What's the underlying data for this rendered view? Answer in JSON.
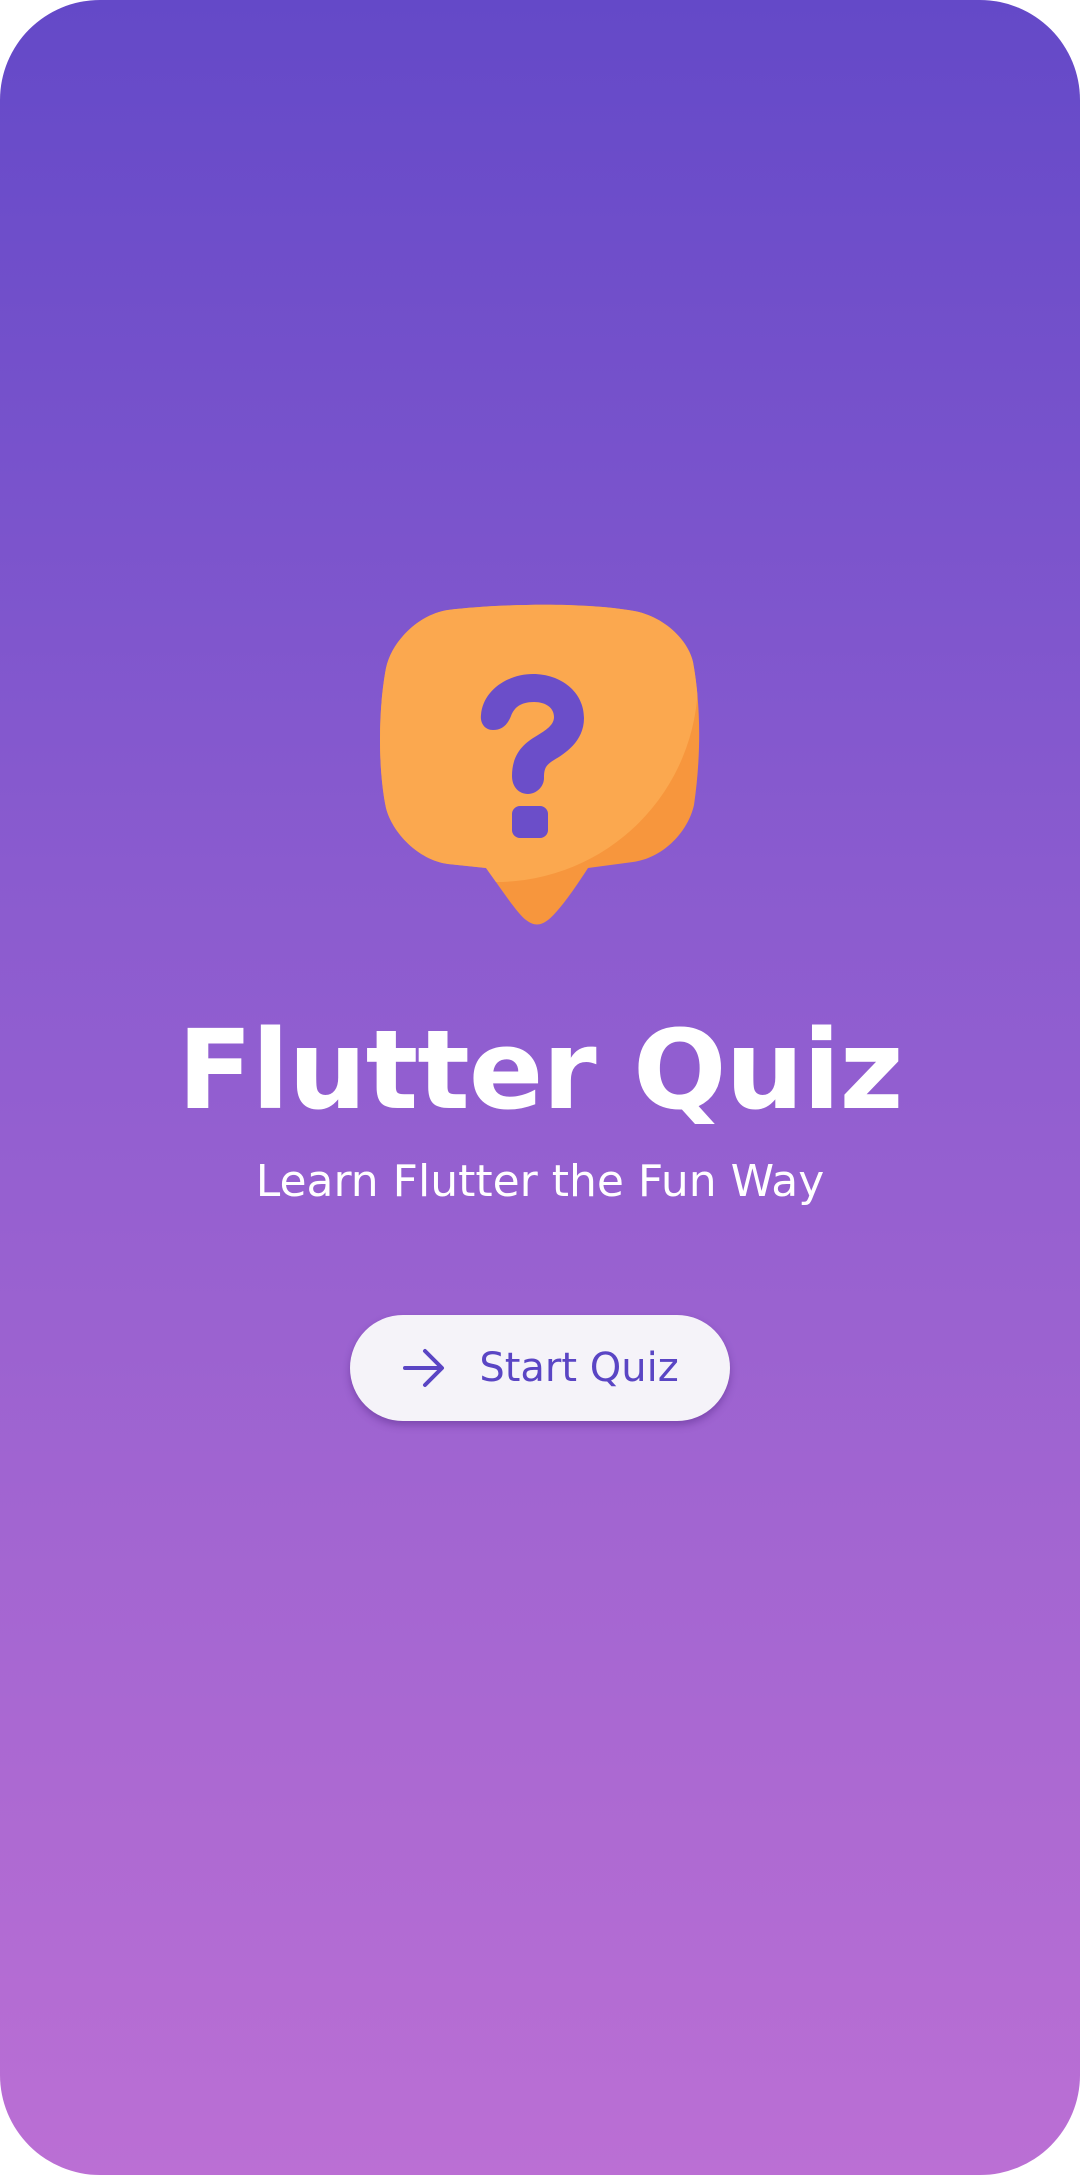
{
  "app": {
    "title": "Flutter Quiz",
    "subtitle": "Learn Flutter the Fun Way"
  },
  "start_button": {
    "label": "Start Quiz",
    "icon": "arrow-right-icon"
  },
  "logo": {
    "icon": "question-bubble-icon"
  },
  "colors": {
    "gradient_top": "#6449c8",
    "gradient_bottom": "#bb6fd4",
    "bubble_light": "#fba84f",
    "bubble_dark": "#f7963d",
    "accent": "#5a45c4",
    "button_bg": "#f5f3f9"
  }
}
